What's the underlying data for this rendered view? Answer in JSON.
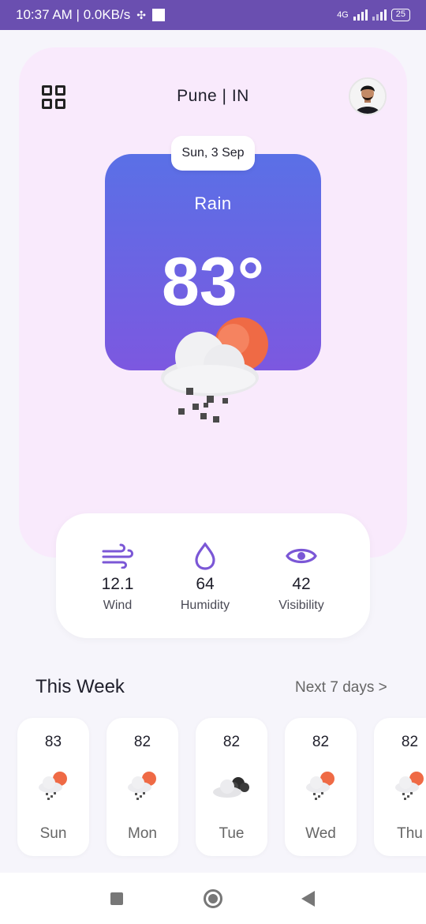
{
  "status": {
    "time_speed": "10:37 AM | 0.0KB/s",
    "network": "4G",
    "battery": "25"
  },
  "header": {
    "location": "Pune | IN"
  },
  "current": {
    "date": "Sun, 3 Sep",
    "condition": "Rain",
    "temperature": "83°"
  },
  "stats": [
    {
      "value": "12.1",
      "label": "Wind",
      "icon": "wind-icon"
    },
    {
      "value": "64",
      "label": "Humidity",
      "icon": "drop-icon"
    },
    {
      "value": "42",
      "label": "Visibility",
      "icon": "eye-icon"
    }
  ],
  "week": {
    "title": "This Week",
    "next_label": "Next 7 days >",
    "days": [
      {
        "temp": "83",
        "day": "Sun",
        "icon": "rain-sun-icon"
      },
      {
        "temp": "82",
        "day": "Mon",
        "icon": "rain-sun-icon"
      },
      {
        "temp": "82",
        "day": "Tue",
        "icon": "cloudy-icon"
      },
      {
        "temp": "82",
        "day": "Wed",
        "icon": "rain-sun-icon"
      },
      {
        "temp": "82",
        "day": "Thu",
        "icon": "rain-sun-icon"
      }
    ]
  },
  "colors": {
    "accent": "#7b57d6",
    "status_bar": "#6a4fb0",
    "card_top": "#5a70e6",
    "card_bottom": "#7c58e0",
    "sun": "#ef6a45"
  }
}
